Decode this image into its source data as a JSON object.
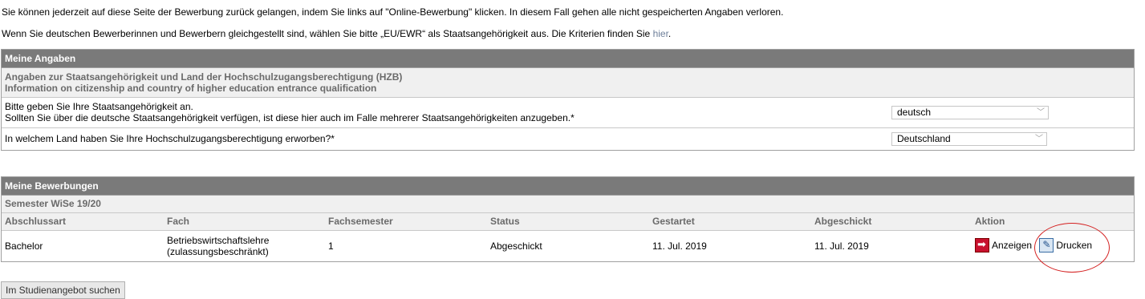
{
  "intro": {
    "line1": "Sie können jederzeit auf diese Seite der Bewerbung zurück gelangen, indem Sie links auf \"Online-Bewerbung\" klicken. In diesem Fall gehen alle nicht gespeicherten Angaben verloren.",
    "line2_text": "Wenn Sie deutschen Bewerberinnen und Bewerbern gleichgestellt sind, wählen Sie bitte „EU/EWR“ als Staatsangehörigkeit aus. Die Kriterien finden Sie ",
    "line2_link": "hier",
    "line2_end": "."
  },
  "meine_angaben": {
    "title": "Meine Angaben",
    "subhead_de": "Angaben zur Staatsangehörigkeit und Land der Hochschulzugangsberechtigung (HZB)",
    "subhead_en": "Information on citizenship and country of higher education entrance qualification",
    "q1_line1": "Bitte geben Sie Ihre Staatsangehörigkeit an.",
    "q1_line2": "Sollten Sie über die deutsche Staatsangehörigkeit verfügen, ist diese hier auch im Falle mehrerer Staatsangehörigkeiten anzugeben.*",
    "q1_value": "deutsch",
    "q2": "In welchem Land haben Sie Ihre Hochschulzugangsberechtigung erworben?*",
    "q2_value": "Deutschland"
  },
  "meine_bewerbungen": {
    "title": "Meine Bewerbungen",
    "semester": "Semester WiSe 19/20",
    "columns": [
      "Abschlussart",
      "Fach",
      "Fachsemester",
      "Status",
      "Gestartet",
      "Abgeschickt",
      "Aktion"
    ],
    "row": {
      "abschlussart": "Bachelor",
      "fach_line1": "Betriebswirtschaftslehre",
      "fach_line2": "(zulassungsbeschränkt)",
      "fachsemester": "1",
      "status": "Abgeschickt",
      "gestartet": "11. Jul. 2019",
      "abgeschickt": "11. Jul. 2019",
      "action_show": "Anzeigen",
      "action_print": "Drucken"
    }
  },
  "search_button": "Im Studienangebot suchen",
  "icons": {
    "show": "arrow-right-icon",
    "print": "print-form-icon"
  },
  "colors": {
    "header_bg": "#7a7a7a",
    "subheader_bg": "#f0f0f0",
    "link": "#6d7f9a",
    "highlight": "#d42020"
  }
}
